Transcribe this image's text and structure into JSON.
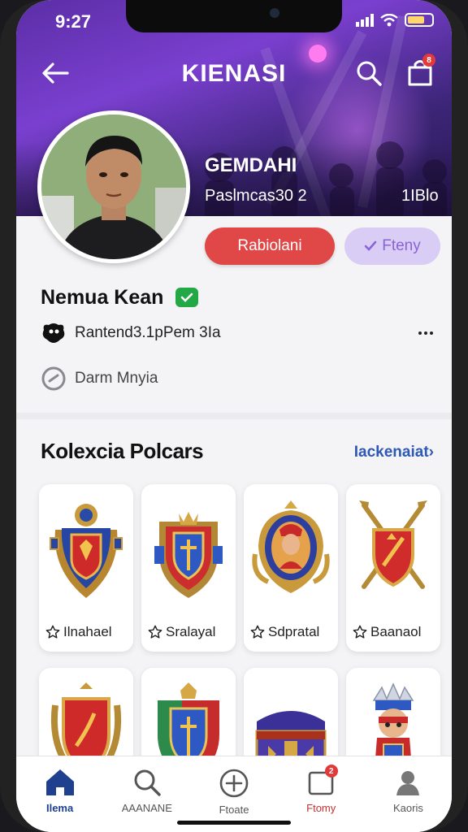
{
  "status": {
    "time": "9:27"
  },
  "header": {
    "title": "KIENASI",
    "bag_badge": "8"
  },
  "banner": {
    "name": "GEMDAHI",
    "subtitle": "Paslmcas30 2",
    "count": "1IBlo"
  },
  "actions": {
    "primary_label": "Rabiolani",
    "secondary_label": "Fteny"
  },
  "profile": {
    "display_name": "Nemua Kean",
    "row1_text": "Rantend3.1pPem 3Ia",
    "row2_text": "Darm Mnyia"
  },
  "collection": {
    "title": "Kolexcia Polcars",
    "link": "Iackenaiat›",
    "items": [
      {
        "label": "Ilnahael",
        "art": "blue-crest-icon"
      },
      {
        "label": "Sralayal",
        "art": "blue-shield-icon"
      },
      {
        "label": "Sdpratal",
        "art": "warrior-badge-icon"
      },
      {
        "label": "Baanaol",
        "art": "crossed-swords-shield-icon"
      },
      {
        "label": "",
        "art": "red-wreath-shield-icon"
      },
      {
        "label": "",
        "art": "green-blue-shield-icon"
      },
      {
        "label": "",
        "art": "treasure-chest-icon"
      },
      {
        "label": "",
        "art": "knight-figure-icon"
      }
    ]
  },
  "tabbar": {
    "tabs": [
      {
        "label": "Ilema"
      },
      {
        "label": "AAANANE"
      },
      {
        "label": "Ftoate"
      },
      {
        "label": "Ftomy",
        "badge": "2"
      },
      {
        "label": "Kaoris"
      }
    ]
  },
  "colors": {
    "accent": "#e04848",
    "link": "#2d58b4",
    "banner": "#6a35c0",
    "verified": "#22a845"
  }
}
